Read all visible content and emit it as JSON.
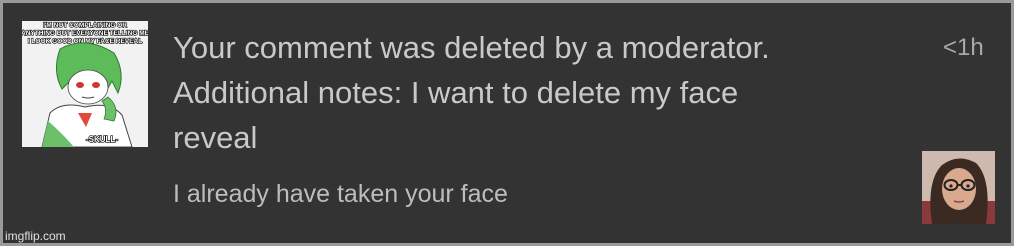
{
  "notification": {
    "thumbnail": {
      "meme_caption": "I'M NOT COMPLAINING OR ANYTHING BUT EVERYONE TELLING ME I LOOK GOOD ON MY FACE REVEAL",
      "meme_footer": "-SKULL-"
    },
    "message_lines": [
      "Your comment was deleted by a moderator.",
      "Additional notes: I want to delete my face",
      "reveal"
    ],
    "timestamp": "<1h",
    "reply_text": "I already have taken your face"
  },
  "watermark": "imgflip.com",
  "colors": {
    "background": "#333333",
    "text_primary": "#c9c9c9",
    "text_secondary": "#a9a9a9",
    "border": "#9a9a9a"
  }
}
